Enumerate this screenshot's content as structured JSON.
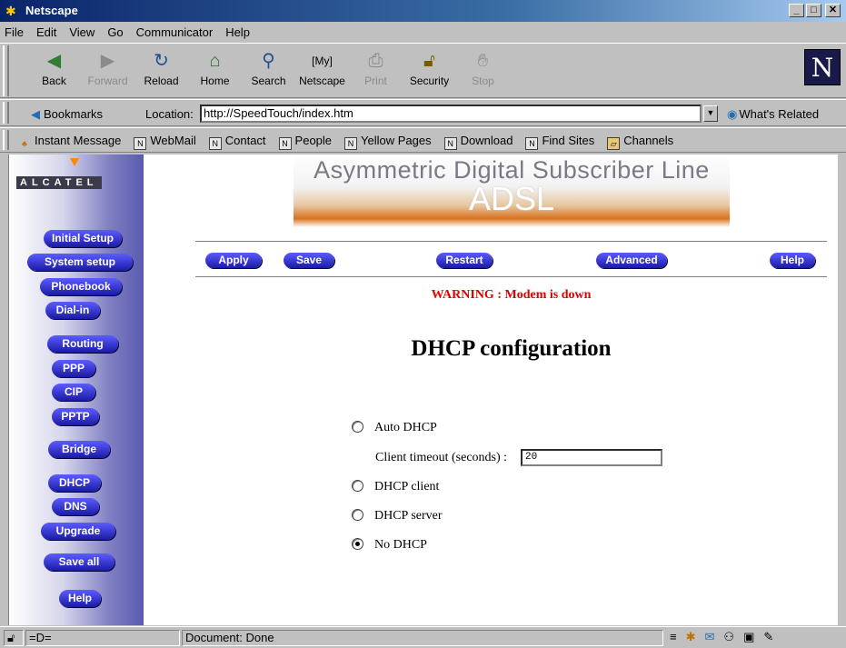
{
  "window": {
    "title": "Netscape"
  },
  "menu": [
    "File",
    "Edit",
    "View",
    "Go",
    "Communicator",
    "Help"
  ],
  "toolbar": [
    {
      "label": "Back",
      "icon": "back-arrow-icon",
      "enabled": true
    },
    {
      "label": "Forward",
      "icon": "forward-arrow-icon",
      "enabled": false
    },
    {
      "label": "Reload",
      "icon": "reload-icon",
      "enabled": true
    },
    {
      "label": "Home",
      "icon": "home-icon",
      "enabled": true
    },
    {
      "label": "Search",
      "icon": "search-icon",
      "enabled": true
    },
    {
      "label": "Netscape",
      "icon": "my-netscape-icon",
      "enabled": true
    },
    {
      "label": "Print",
      "icon": "print-icon",
      "enabled": false
    },
    {
      "label": "Security",
      "icon": "lock-icon",
      "enabled": true
    },
    {
      "label": "Stop",
      "icon": "stop-icon",
      "enabled": false
    }
  ],
  "location": {
    "bookmarks": "Bookmarks",
    "label": "Location:",
    "url": "http://SpeedTouch/index.htm",
    "related": "What's Related"
  },
  "personal": [
    "Instant Message",
    "WebMail",
    "Contact",
    "People",
    "Yellow Pages",
    "Download",
    "Find Sites",
    "Channels"
  ],
  "page": {
    "brand": "ALCATEL",
    "banner_sub": "Asymmetric Digital Subscriber Line",
    "banner_big": "ADSL",
    "nav": [
      "Initial Setup",
      "System setup",
      "Phonebook",
      "Dial-in",
      "Routing",
      "PPP",
      "CIP",
      "PPTP",
      "Bridge",
      "DHCP",
      "DNS",
      "Upgrade",
      "Save all",
      "Help"
    ],
    "actions": [
      "Apply",
      "Save",
      "Restart",
      "Advanced",
      "Help"
    ],
    "warning": "WARNING : Modem is down",
    "heading": "DHCP configuration",
    "options": [
      {
        "label": "Auto DHCP",
        "selected": false
      },
      {
        "label": "DHCP client",
        "selected": false
      },
      {
        "label": "DHCP server",
        "selected": false
      },
      {
        "label": "No DHCP",
        "selected": true
      }
    ],
    "timeout_label": "Client timeout (seconds) :",
    "timeout_value": "20"
  },
  "status": {
    "text": "Document: Done"
  },
  "colors": {
    "nav_button": "#2a2ad0",
    "warning": "#e00000",
    "banner_accent": "#d8731f"
  }
}
